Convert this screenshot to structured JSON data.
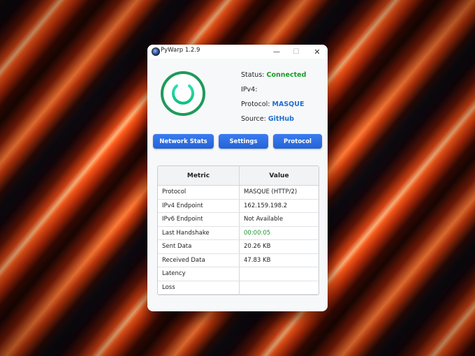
{
  "window": {
    "title": "PyWarp 1.2.9"
  },
  "window_controls": {
    "minimize": "—",
    "maximize": "☐",
    "close": "✕"
  },
  "status": {
    "status_label": "Status:",
    "status_value": "Connected",
    "ipv4_label": "IPv4:",
    "ipv4_value": "",
    "protocol_label": "Protocol:",
    "protocol_value": "MASQUE",
    "source_label": "Source:",
    "source_value": "GitHub"
  },
  "buttons": {
    "network_stats": "Network Stats",
    "settings": "Settings",
    "protocol": "Protocol"
  },
  "table": {
    "headers": [
      "Metric",
      "Value"
    ],
    "rows": [
      {
        "metric": "Protocol",
        "value": "MASQUE (HTTP/2)"
      },
      {
        "metric": "IPv4 Endpoint",
        "value": "162.159.198.2"
      },
      {
        "metric": "IPv6 Endpoint",
        "value": "Not Available"
      },
      {
        "metric": "Last Handshake",
        "value": "00:00:05"
      },
      {
        "metric": "Sent Data",
        "value": "20.26 KB"
      },
      {
        "metric": "Received Data",
        "value": "47.83 KB"
      },
      {
        "metric": "Latency",
        "value": ""
      },
      {
        "metric": "Loss",
        "value": ""
      }
    ]
  },
  "colors": {
    "connected": "#1a9a2a",
    "link": "#1f6fd1",
    "button": "#2f6fe4",
    "power_ring": "#1f9a5a"
  },
  "icons": {
    "power": "power-icon",
    "app": "app-icon"
  }
}
